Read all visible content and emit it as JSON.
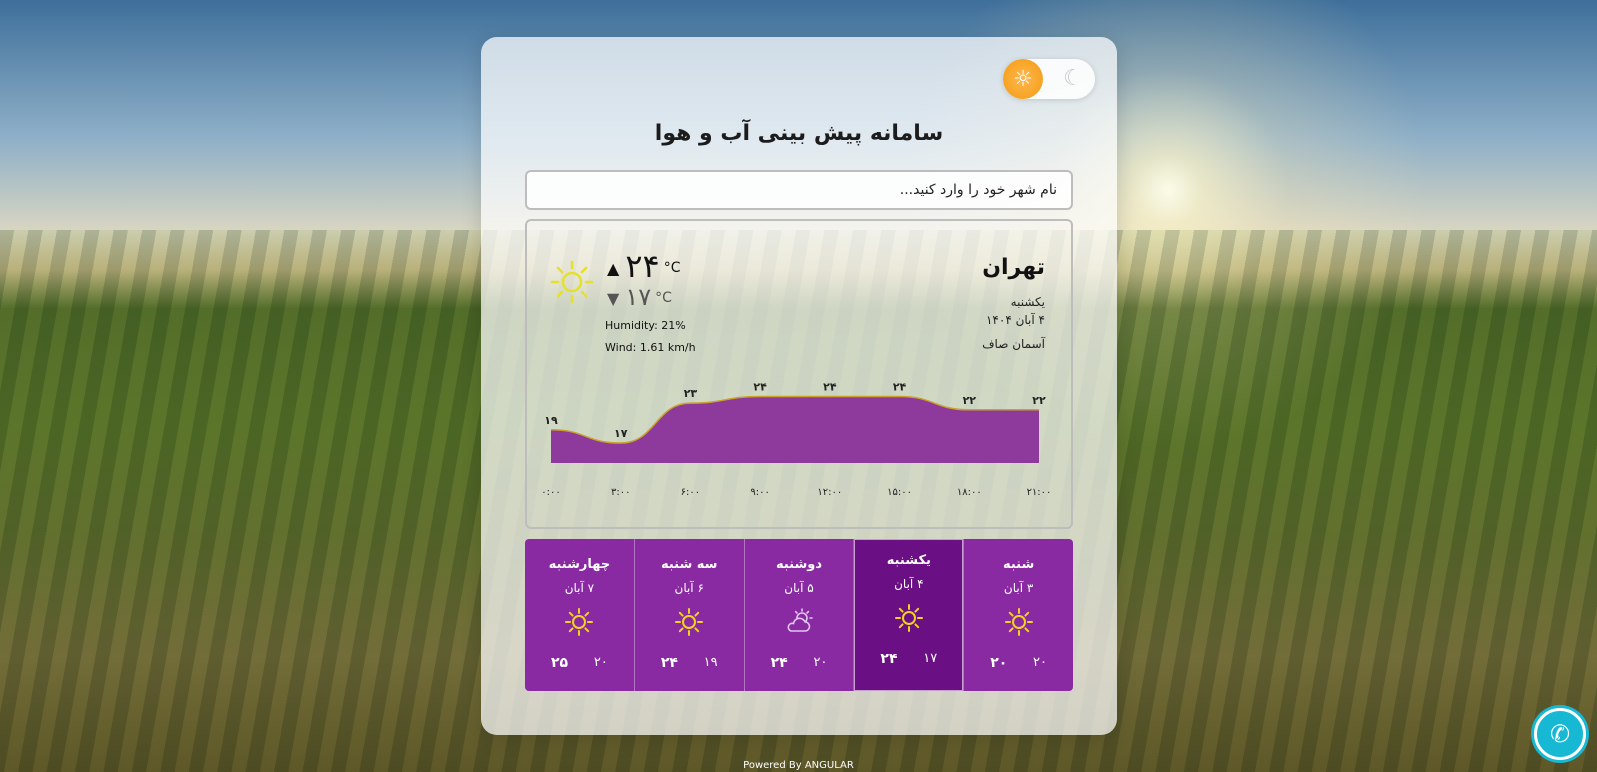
{
  "header": {
    "title": "سامانه پیش بینی آب و هوا"
  },
  "search": {
    "placeholder": "نام شهر خود را وارد کنید..."
  },
  "current": {
    "city": "تهران",
    "day": "یکشنبه",
    "date": "۴ آبان ۱۴۰۴",
    "description": "آسمان صاف",
    "temp_max": "۲۴",
    "temp_min": "۱۷",
    "unit": "°C",
    "up_arrow": "▲",
    "down_arrow": "▼",
    "humidity": "Humidity: 21%",
    "wind": "Wind: 1.61 km/h",
    "icon": "sun-icon"
  },
  "chart_data": {
    "type": "area",
    "x": [
      "۰:۰۰",
      "۳:۰۰",
      "۶:۰۰",
      "۹:۰۰",
      "۱۲:۰۰",
      "۱۵:۰۰",
      "۱۸:۰۰",
      "۲۱:۰۰"
    ],
    "values": [
      19,
      17,
      23,
      24,
      24,
      24,
      22,
      22
    ],
    "value_labels": [
      "۱۹",
      "۱۷",
      "۲۳",
      "۲۴",
      "۲۴",
      "۲۴",
      "۲۲",
      "۲۲"
    ],
    "fill_color": "#8e3a9d",
    "line_color": "#c9a227"
  },
  "forecast": [
    {
      "name": "شنبه",
      "date": "۳ آبان",
      "min": "۲۰",
      "max": "۲۰",
      "icon": "sun-icon",
      "active": false
    },
    {
      "name": "یکشنبه",
      "date": "۴ آبان",
      "min": "۱۷",
      "max": "۲۴",
      "icon": "sun-icon",
      "active": true
    },
    {
      "name": "دوشنبه",
      "date": "۵ آبان",
      "min": "۲۰",
      "max": "۲۴",
      "icon": "partly-cloudy-icon",
      "active": false
    },
    {
      "name": "سه شنبه",
      "date": "۶ آبان",
      "min": "۱۹",
      "max": "۲۴",
      "icon": "sun-icon",
      "active": false
    },
    {
      "name": "چهارشنبه",
      "date": "۷ آبان",
      "min": "۲۰",
      "max": "۲۵",
      "icon": "sun-icon",
      "active": false
    }
  ],
  "theme": {
    "sun_glyph": "☼",
    "moon_glyph": "☾"
  },
  "footer": {
    "text": "Powered By ANGULAR"
  },
  "phone": {
    "glyph": "✆"
  },
  "colors": {
    "accent_purple": "#8a2aa3",
    "active_purple": "#6b0f84",
    "toggle_orange": "#f29a12",
    "phone_cyan": "#17b8d4",
    "sun_yellow": "#f3d21f"
  }
}
